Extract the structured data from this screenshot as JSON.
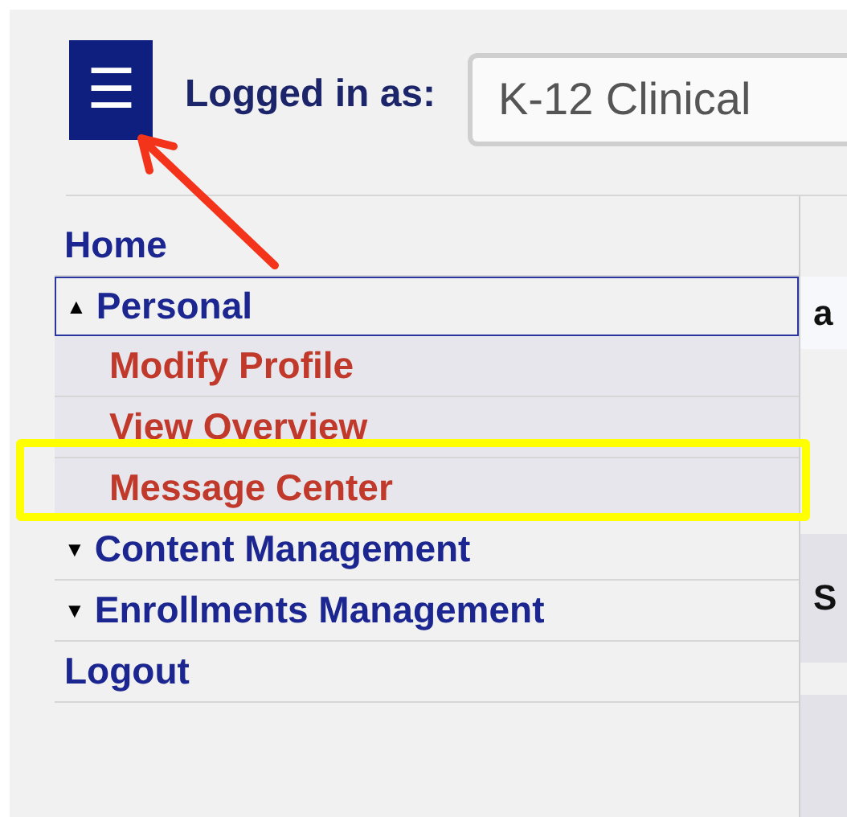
{
  "header": {
    "menu_button": {
      "label": "☰"
    },
    "logged_in_label": "Logged in as:",
    "account_select": {
      "value": "K-12 Clinical"
    }
  },
  "menu": [
    {
      "kind": "link",
      "label": "Home"
    },
    {
      "kind": "section",
      "marker": "▲",
      "label": "Personal",
      "focused": true,
      "children": [
        {
          "label": "Modify Profile"
        },
        {
          "label": "View Overview"
        },
        {
          "label": "Message Center",
          "highlighted": true
        }
      ]
    },
    {
      "kind": "section",
      "marker": "▼",
      "label": "Content Management",
      "focused": false
    },
    {
      "kind": "section",
      "marker": "▼",
      "label": "Enrollments Management",
      "focused": false
    },
    {
      "kind": "link",
      "label": "Logout"
    }
  ],
  "content_fragments": [
    "a",
    "S"
  ]
}
